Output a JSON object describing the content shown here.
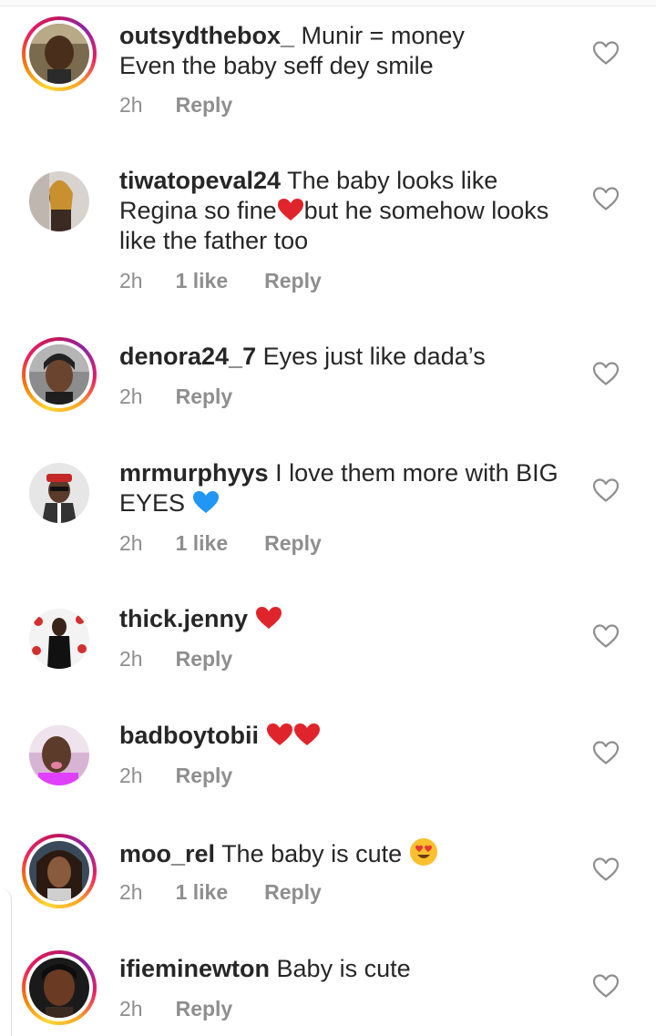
{
  "comments": [
    {
      "username": "outsydthebox_",
      "line1": "Munir = money",
      "line2": "Even the baby seff dey smile",
      "time": "2h",
      "likes": "",
      "reply": "Reply",
      "avatar": "photo-man",
      "story": true
    },
    {
      "username": "tiwatopeval24",
      "pre": "The baby looks like",
      "l2a": "Regina so fine",
      "l2b": "but he somehow looks",
      "l3": "like the father too",
      "time": "2h",
      "likes": "1 like",
      "reply": "Reply",
      "avatar": "photo-woman-braids",
      "story": false
    },
    {
      "username": "denora24_7",
      "text": "Eyes just like dada’s",
      "time": "2h",
      "likes": "",
      "reply": "Reply",
      "avatar": "photo-woman",
      "story": true
    },
    {
      "username": "mrmurphyys",
      "pre": "I love them more with BIG",
      "l2": "EYES",
      "time": "2h",
      "likes": "1 like",
      "reply": "Reply",
      "avatar": "photo-man-cap",
      "story": false
    },
    {
      "username": "thick.jenny",
      "time": "2h",
      "likes": "",
      "reply": "Reply",
      "avatar": "photo-woman-banner",
      "story": false
    },
    {
      "username": "badboytobii",
      "time": "2h",
      "likes": "",
      "reply": "Reply",
      "avatar": "photo-boy",
      "story": false
    },
    {
      "username": "moo_rel",
      "text": "The baby is cute",
      "time": "2h",
      "likes": "1 like",
      "reply": "Reply",
      "avatar": "photo-woman-hair",
      "story": true
    },
    {
      "username": "ifieminewton",
      "text": "Baby is cute",
      "time": "2h",
      "likes": "",
      "reply": "Reply",
      "avatar": "photo-woman-dark",
      "story": true
    }
  ],
  "icons": {
    "like": "heart-outline-icon",
    "emoji_heart": "red-heart-emoji",
    "emoji_blue_heart": "blue-heart-emoji",
    "emoji_heart_eyes": "heart-eyes-emoji"
  },
  "colors": {
    "text": "#262626",
    "meta": "#8e8e8e",
    "heart_red": "#e0242b",
    "heart_blue": "#2196f3",
    "story_ring": "#e91e63"
  }
}
